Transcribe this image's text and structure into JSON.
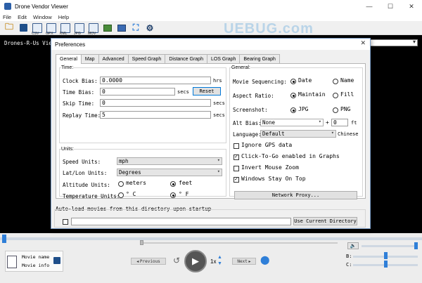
{
  "app": {
    "title": "Drone Vendor Viewer",
    "window_controls": {
      "minimize": "—",
      "maximize": "☐",
      "close": "✕"
    }
  },
  "menu": [
    "File",
    "Edit",
    "Window",
    "Help"
  ],
  "toolbar": {
    "buttons": [
      {
        "label": "",
        "icon": "open-folder-icon"
      },
      {
        "label": "",
        "icon": "save-icon"
      },
      {
        "label": "CSV",
        "icon": "csv-export-icon"
      },
      {
        "label": "GPX",
        "icon": "gpx-export-icon"
      },
      {
        "label": "KML",
        "icon": "kml-export-icon"
      },
      {
        "label": "JPG",
        "icon": "jpg-export-icon"
      },
      {
        "label": "MOV",
        "icon": "mov-export-icon"
      },
      {
        "label": "",
        "icon": "picture-icon"
      },
      {
        "label": "",
        "icon": "screenshot-icon"
      },
      {
        "label": "",
        "icon": "fullscreen-icon"
      },
      {
        "label": "",
        "icon": "settings-gear-icon"
      }
    ],
    "watermark": "UEBUG.com"
  },
  "video": {
    "label": "Drones-R-Us View"
  },
  "dialog": {
    "title": "Preferences",
    "close": "✕",
    "tabs": [
      "General",
      "Map",
      "Advanced",
      "Speed Graph",
      "Distance Graph",
      "LOS Graph",
      "Bearing Graph"
    ],
    "active_tab": "General",
    "time": {
      "title": "Time:",
      "clock_bias_label": "Clock Bias:",
      "clock_bias_value": "0.0000",
      "clock_bias_unit": "hrs",
      "time_bias_label": "Time Bias:",
      "time_bias_value": "0",
      "time_bias_unit": "secs",
      "reset_label": "Reset",
      "skip_time_label": "Skip Time:",
      "skip_time_value": "0",
      "skip_time_unit": "secs",
      "replay_time_label": "Replay Time:",
      "replay_time_value": "5",
      "replay_time_unit": "secs"
    },
    "units": {
      "title": "Units:",
      "speed_label": "Speed Units:",
      "speed_value": "mph",
      "latlon_label": "Lat/Lon Units:",
      "latlon_value": "Degrees",
      "altitude_label": "Altitude Units:",
      "altitude_options": [
        "meters",
        "feet"
      ],
      "altitude_selected": "feet",
      "temperature_label": "Temperature Units:",
      "temperature_options": [
        "° C",
        "° F"
      ],
      "temperature_selected": "° F"
    },
    "general": {
      "title": "General:",
      "sequencing_label": "Movie Sequencing:",
      "sequencing_options": [
        "Date",
        "Name"
      ],
      "sequencing_selected": "Date",
      "aspect_label": "Aspect Ratio:",
      "aspect_options": [
        "Maintain",
        "Fill"
      ],
      "aspect_selected": "Maintain",
      "screenshot_label": "Screenshot:",
      "screenshot_options": [
        "JPG",
        "PNG"
      ],
      "screenshot_selected": "JPG",
      "alt_bias_label": "Alt Bias:",
      "alt_bias_select": "None",
      "alt_bias_plus": "+",
      "alt_bias_value": "0",
      "alt_bias_unit": "ft",
      "language_label": "Language:",
      "language_value": "Default",
      "language_current": "Chinese",
      "checkboxes": [
        {
          "label": "Ignore GPS data",
          "checked": false
        },
        {
          "label": "Click-To-Go enabled in Graphs",
          "checked": true
        },
        {
          "label": "Invert Mouse Zoom",
          "checked": false
        },
        {
          "label": "Windows Stay On Top",
          "checked": true
        }
      ],
      "proxy_label": "Network Proxy..."
    },
    "autoload": {
      "label": "Auto-load movies from this directory upon startup",
      "path": "",
      "checked": false,
      "use_current_label": "Use Current Directory"
    }
  },
  "player": {
    "movie_name_label": "Movie name",
    "movie_info_label": "Movie info",
    "prev_label": "Previous",
    "next_label": "Next",
    "speed": "1x",
    "b_label": "B:",
    "c_label": "C:",
    "position": 0.0
  }
}
